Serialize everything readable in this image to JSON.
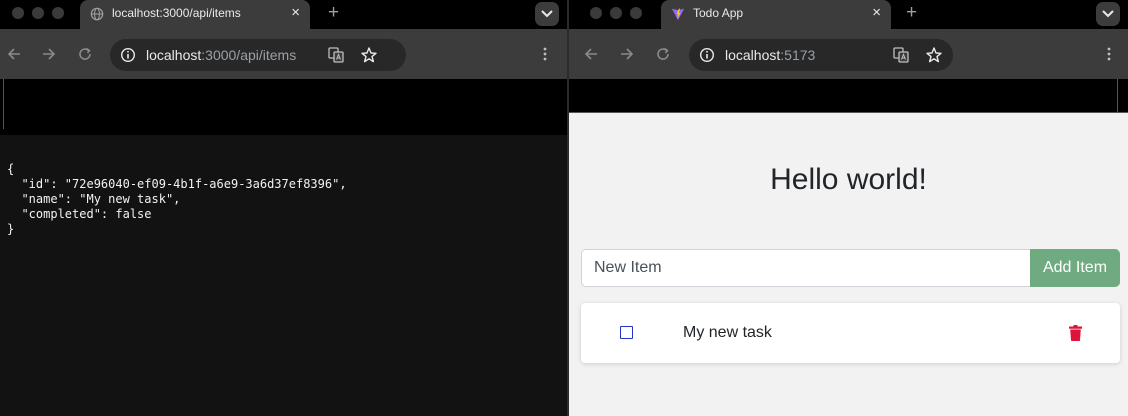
{
  "left_window": {
    "tab_title": "localhost:3000/api/items",
    "url_host": "localhost",
    "url_rest": ":3000/api/items",
    "json_lines": [
      "{",
      "  \"id\": \"72e96040-ef09-4b1f-a6e9-3a6d37ef8396\",",
      "  \"name\": \"My new task\",",
      "  \"completed\": false",
      "}"
    ]
  },
  "right_window": {
    "tab_title": "Todo App",
    "url_host": "localhost",
    "url_rest": ":5173"
  },
  "todo_app": {
    "heading": "Hello world!",
    "new_item_placeholder": "New Item",
    "add_button_label": "Add Item",
    "items": [
      {
        "name": "My new task",
        "completed": false
      }
    ]
  },
  "icons": {
    "tab_close": "×",
    "new_tab": "+",
    "star": "star-icon",
    "translate": "translate-icon",
    "info": "info-icon",
    "trash": "trash-icon"
  },
  "colors": {
    "add_button": "#6faa80",
    "delete_icon": "#dc143c",
    "checkbox_border": "#1f35c9"
  }
}
